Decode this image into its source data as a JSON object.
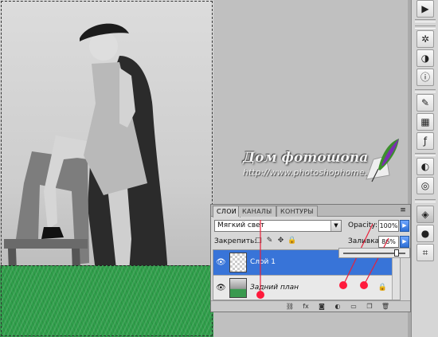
{
  "watermark": {
    "title": "Дом фотошопа",
    "url": "http://www.photoshophome.ru"
  },
  "layers_panel": {
    "tabs": [
      "СЛОИ",
      "КАНАЛЫ",
      "КОНТУРЫ"
    ],
    "menu_icon": "panel-menu-icon",
    "blend_mode": "Мягкий свет",
    "opacity_label": "Opacity:",
    "opacity_value": "100%",
    "lock_label": "Закрепить:",
    "fill_label": "Заливка:",
    "fill_value": "86%",
    "fill_slider_fraction": 0.86,
    "layers": [
      {
        "name": "Слой 1",
        "selected": true,
        "visible": true,
        "thumbnail": "transparent"
      },
      {
        "name": "Задний план",
        "selected": false,
        "visible": true,
        "thumbnail": "photo",
        "locked": true
      }
    ],
    "footer_icons": [
      "link-icon",
      "fx-icon",
      "mask-icon",
      "adjustment-icon",
      "group-icon",
      "new-layer-icon",
      "trash-icon"
    ]
  },
  "tool_strip": {
    "icons": [
      "play-icon",
      "gear-icon",
      "palette-icon",
      "histogram-icon",
      "info-icon",
      "brush-icon",
      "clone-icon",
      "grid-icon",
      "fx-icon",
      "mask-icon",
      "layers-icon",
      "channels-icon",
      "paths-icon"
    ]
  },
  "colors": {
    "selection_blue": "#3874d8",
    "grass_green": "#2f9e4a",
    "annotation_red": "#e8203a"
  }
}
